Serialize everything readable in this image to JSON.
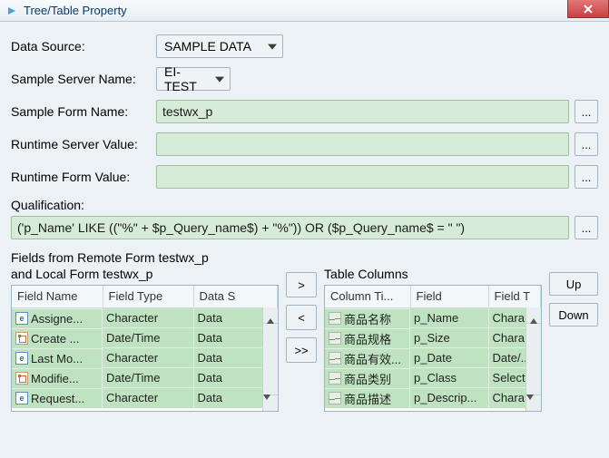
{
  "window": {
    "title": "Tree/Table Property"
  },
  "labels": {
    "data_source": "Data Source:",
    "sample_server_name": "Sample Server Name:",
    "sample_form_name": "Sample Form Name:",
    "runtime_server_value": "Runtime Server Value:",
    "runtime_form_value": "Runtime Form Value:",
    "qualification": "Qualification:",
    "fields_heading_line1": "Fields from Remote Form testwx_p",
    "fields_heading_line2": "and Local Form testwx_p",
    "table_columns": "Table Columns"
  },
  "values": {
    "data_source": "SAMPLE DATA",
    "sample_server": "EI-TEST",
    "sample_form": "testwx_p",
    "runtime_server": "",
    "runtime_form": "",
    "qualification": "('p_Name' LIKE ((\"%\" + $p_Query_name$) + \"%\")) OR ($p_Query_name$ = \" \")"
  },
  "buttons": {
    "ellipsis": "...",
    "move_right": ">",
    "move_left": "<",
    "move_all_right": ">>",
    "up": "Up",
    "down": "Down"
  },
  "left_table": {
    "headers": [
      "Field Name",
      "Field Type",
      "Data S"
    ],
    "rows": [
      {
        "icon": "e",
        "c0": "Assigne...",
        "c1": "Character",
        "c2": "Data"
      },
      {
        "icon": "d",
        "c0": "Create ...",
        "c1": "Date/Time",
        "c2": "Data"
      },
      {
        "icon": "e",
        "c0": "Last Mo...",
        "c1": "Character",
        "c2": "Data"
      },
      {
        "icon": "d",
        "c0": "Modifie...",
        "c1": "Date/Time",
        "c2": "Data"
      },
      {
        "icon": "e",
        "c0": "Request...",
        "c1": "Character",
        "c2": "Data"
      }
    ]
  },
  "right_table": {
    "headers": [
      "Column Ti...",
      "Field",
      "Field T"
    ],
    "rows": [
      {
        "c0": "商品名称",
        "c1": "p_Name",
        "c2": "Chara..."
      },
      {
        "c0": "商品规格",
        "c1": "p_Size",
        "c2": "Chara..."
      },
      {
        "c0": "商品有效...",
        "c1": "p_Date",
        "c2": "Date/..."
      },
      {
        "c0": "商品类别",
        "c1": "p_Class",
        "c2": "Select..."
      },
      {
        "c0": "商品描述",
        "c1": "p_Descrip...",
        "c2": "Chara..."
      }
    ]
  }
}
